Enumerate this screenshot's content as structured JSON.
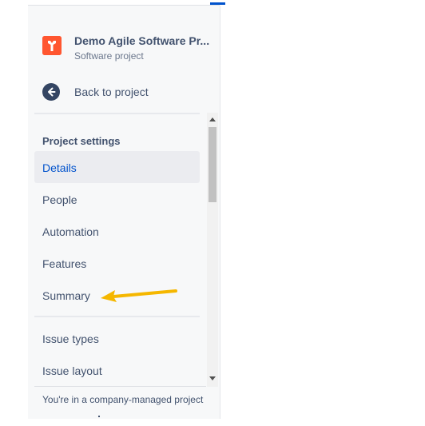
{
  "project": {
    "name": "Demo Agile Software Pr...",
    "type": "Software project",
    "avatar_color": "#ff5630"
  },
  "back": {
    "label": "Back to project",
    "icon": "arrow-left-icon"
  },
  "settings": {
    "title": "Project settings",
    "items": [
      {
        "label": "Details",
        "active": true
      },
      {
        "label": "People",
        "active": false
      },
      {
        "label": "Automation",
        "active": false
      },
      {
        "label": "Features",
        "active": false
      },
      {
        "label": "Summary",
        "active": false
      },
      {
        "label": "Issue types",
        "active": false
      },
      {
        "label": "Issue layout",
        "active": false
      }
    ]
  },
  "footer": {
    "text": "You're in a company-managed project"
  },
  "annotation": {
    "color": "#f5b700",
    "target": "Summary"
  },
  "colors": {
    "active_text": "#0052cc",
    "active_bg": "#ebecf0",
    "sidebar_bg": "#f7f8f9"
  }
}
